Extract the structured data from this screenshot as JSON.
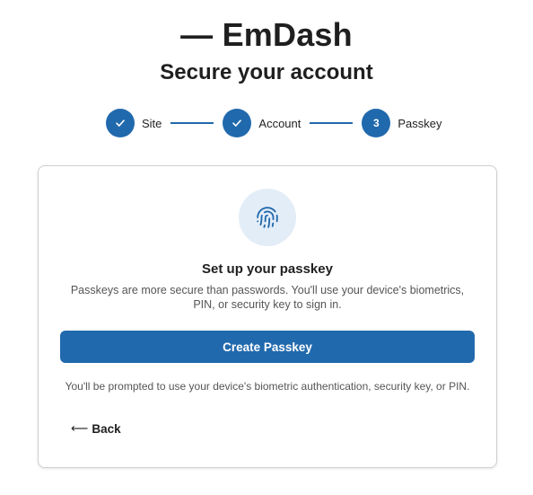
{
  "brand": {
    "logo_text": "— EmDash"
  },
  "page": {
    "heading": "Secure your account"
  },
  "stepper": {
    "steps": [
      {
        "label": "Site",
        "status": "complete",
        "icon": "check-icon"
      },
      {
        "label": "Account",
        "status": "complete",
        "icon": "check-icon"
      },
      {
        "label": "Passkey",
        "status": "current",
        "number": "3"
      }
    ]
  },
  "card": {
    "icon": "fingerprint-icon",
    "title": "Set up your passkey",
    "description": "Passkeys are more secure than passwords. You'll use your device's biometrics, PIN, or security key to sign in.",
    "button_label": "Create Passkey",
    "hint": "You'll be prompted to use your device's biometric authentication, security key, or PIN.",
    "back_arrow": "⟵",
    "back_label": "Back"
  },
  "colors": {
    "accent": "#2169ad",
    "icon_bg": "#e3edf7",
    "text": "#1f1f1f",
    "muted_text": "#555555",
    "border": "#d0d0d0"
  }
}
